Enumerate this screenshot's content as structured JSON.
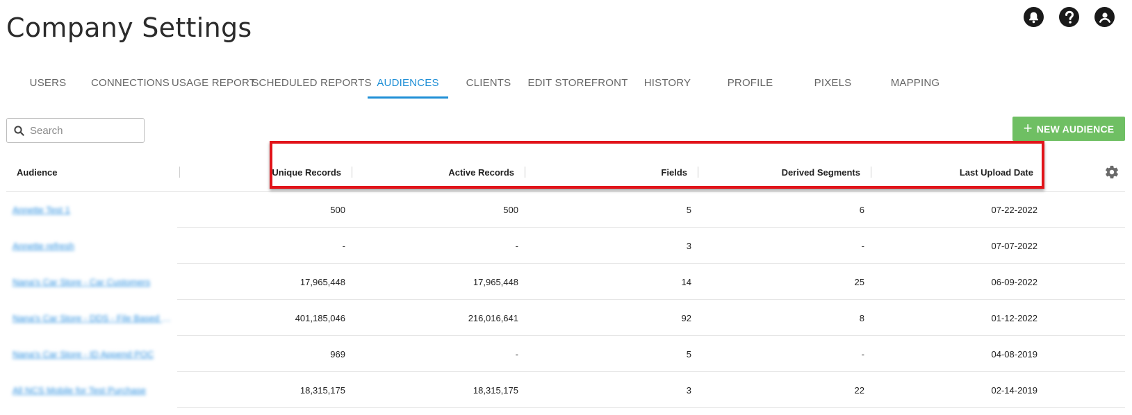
{
  "page": {
    "title": "Company Settings"
  },
  "header_icons": [
    "bell-icon",
    "help-icon",
    "account-icon"
  ],
  "tabs": [
    {
      "label": "USERS",
      "active": false
    },
    {
      "label": "CONNECTIONS",
      "active": false
    },
    {
      "label": "USAGE REPORT",
      "active": false
    },
    {
      "label": "SCHEDULED REPORTS",
      "active": false
    },
    {
      "label": "AUDIENCES",
      "active": true
    },
    {
      "label": "CLIENTS",
      "active": false
    },
    {
      "label": "EDIT STOREFRONT",
      "active": false
    },
    {
      "label": "HISTORY",
      "active": false
    },
    {
      "label": "PROFILE",
      "active": false
    },
    {
      "label": "PIXELS",
      "active": false
    },
    {
      "label": "MAPPING",
      "active": false
    }
  ],
  "search": {
    "placeholder": "Search",
    "value": ""
  },
  "toolbar": {
    "new_audience_label": "NEW AUDIENCE"
  },
  "colors": {
    "accent": "#1f8fd6",
    "button_green": "#6fbf63",
    "highlight_red": "#e1141a",
    "link": "#2a8fe0"
  },
  "table": {
    "headers": {
      "audience": "Audience",
      "unique_records": "Unique Records",
      "active_records": "Active Records",
      "fields": "Fields",
      "derived_segments": "Derived Segments",
      "last_upload_date": "Last Upload Date"
    },
    "rows": [
      {
        "audience": "Annette Test 1",
        "unique": "500",
        "active": "500",
        "fields": "5",
        "derived": "6",
        "date": "07-22-2022"
      },
      {
        "audience": "Annette refresh",
        "unique": "-",
        "active": "-",
        "fields": "3",
        "derived": "-",
        "date": "07-07-2022"
      },
      {
        "audience": "Nana's Car Store - Car Customers",
        "unique": "17,965,448",
        "active": "17,965,448",
        "fields": "14",
        "derived": "25",
        "date": "06-09-2022"
      },
      {
        "audience": "Nana's Car Store - DDS - File Based Segments",
        "unique": "401,185,046",
        "active": "216,016,641",
        "fields": "92",
        "derived": "8",
        "date": "01-12-2022"
      },
      {
        "audience": "Nana's Car Store - ID Append POC",
        "unique": "969",
        "active": "-",
        "fields": "5",
        "derived": "-",
        "date": "04-08-2019"
      },
      {
        "audience": "All NCS Mobile for Test Purchase",
        "unique": "18,315,175",
        "active": "18,315,175",
        "fields": "3",
        "derived": "22",
        "date": "02-14-2019"
      }
    ]
  }
}
